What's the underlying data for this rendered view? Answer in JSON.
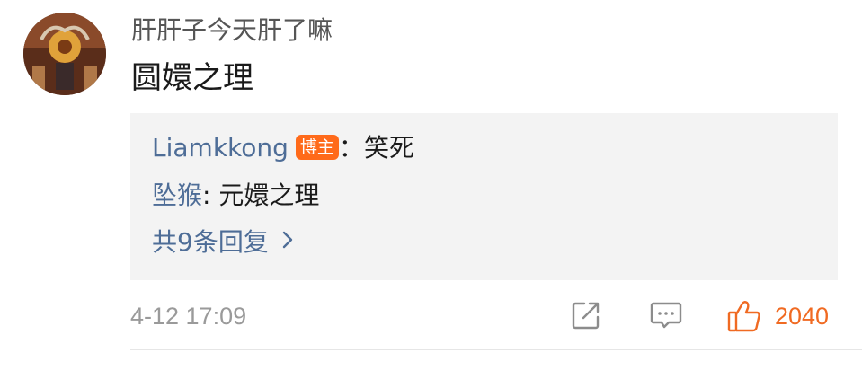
{
  "comment": {
    "username": "肝肝子今天肝了嘛",
    "content": "圆嬛之理",
    "timestamp": "4-12 17:09",
    "like_count": "2040"
  },
  "replies": [
    {
      "author": "Liamkkong",
      "badge": "博主",
      "separator": "：",
      "text": "笑死"
    },
    {
      "author": "坠猴",
      "separator": ": ",
      "text": "元嬛之理"
    }
  ],
  "more_replies_label": "共9条回复",
  "icons": {
    "share": "share-icon",
    "reply": "comment-icon",
    "like": "thumbs-up-icon",
    "more": "chevron-right-icon"
  },
  "colors": {
    "link": "#4e6d97",
    "badge": "#ff6a1a",
    "like": "#f06a22",
    "meta": "#9a9a9a",
    "reply_bg": "#f3f3f3"
  }
}
